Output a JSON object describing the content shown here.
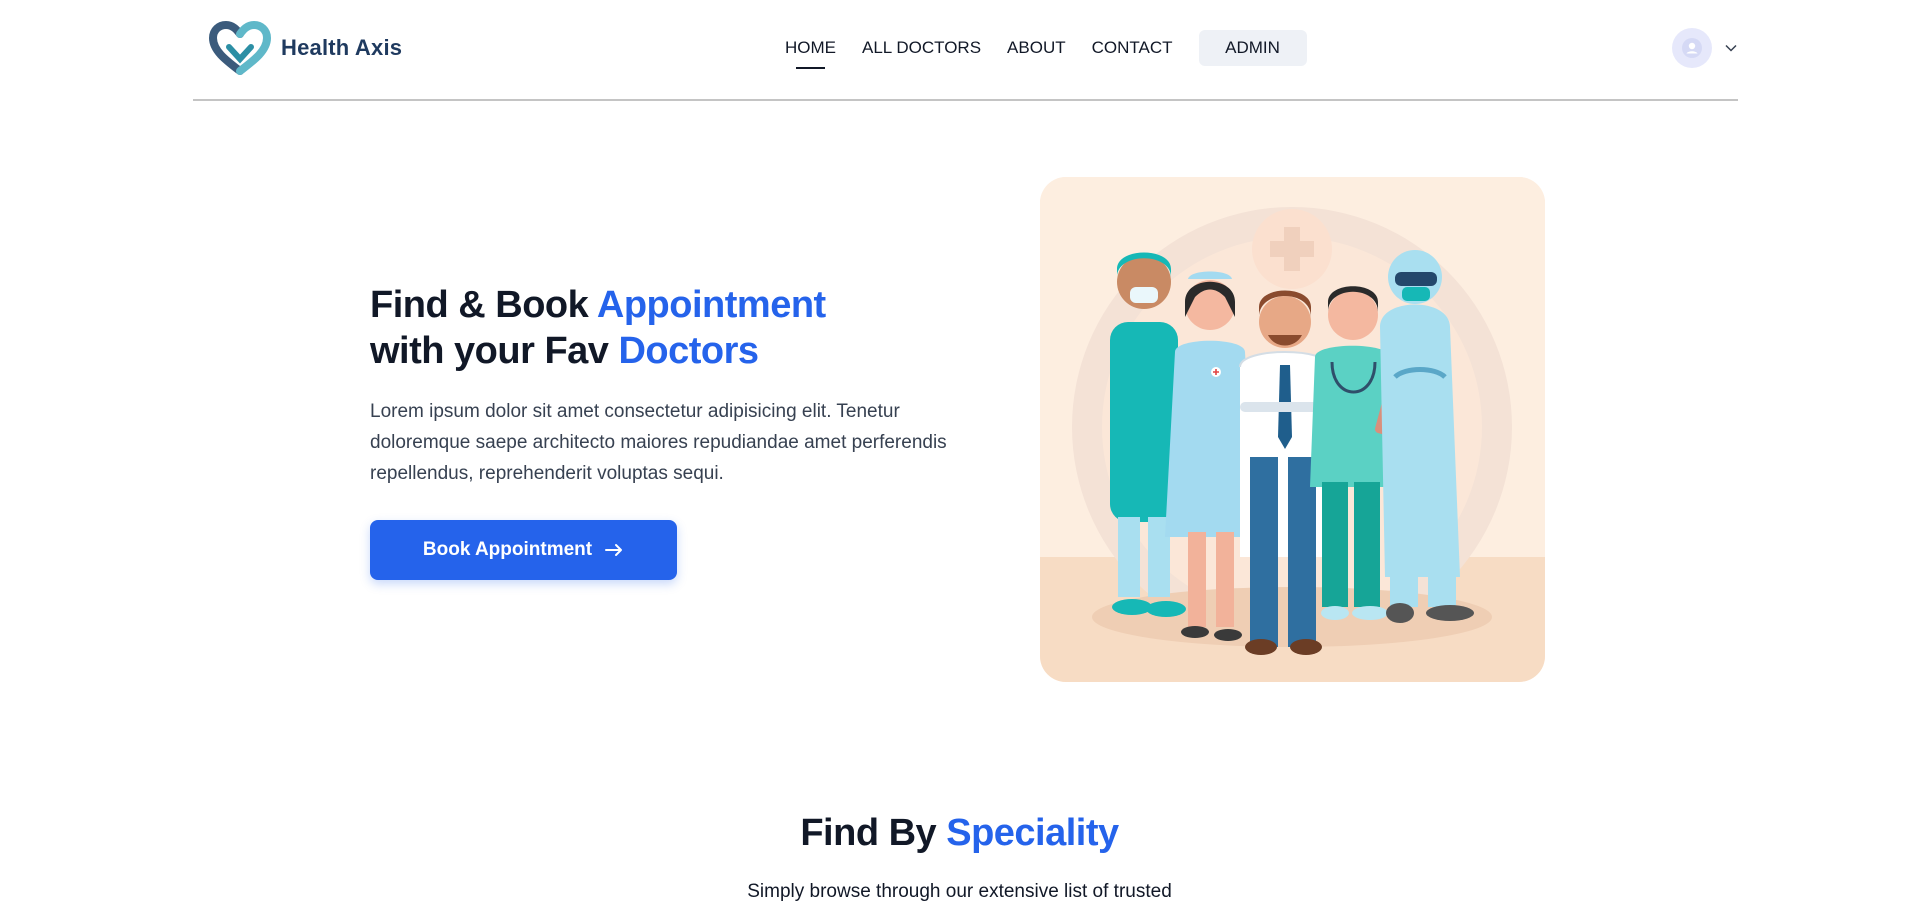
{
  "brand": {
    "name": "Health Axis",
    "primary_color": "#2563eb"
  },
  "nav": {
    "links": [
      "HOME",
      "ALL DOCTORS",
      "ABOUT",
      "CONTACT"
    ],
    "active": "HOME",
    "admin_label": "ADMIN",
    "profile_icon": "user-avatar-icon",
    "menu_icon": "chevron-down-icon"
  },
  "hero": {
    "title_part1": "Find & Book ",
    "title_highlight1": "Appointment",
    "title_part2": "with your Fav ",
    "title_highlight2": "Doctors",
    "description": "Lorem ipsum dolor sit amet consectetur adipisicing elit. Tenetur doloremque saepe architecto maiores repudiandae amet perferendis repellendus, reprehenderit voluptas sequi.",
    "cta_label": "Book Appointment",
    "cta_icon": "arrow-right-icon",
    "illustration": "medical-team-illustration"
  },
  "speciality": {
    "title_part1": "Find By ",
    "title_highlight": "Speciality",
    "subtitle": "Simply browse through our extensive list of trusted"
  }
}
